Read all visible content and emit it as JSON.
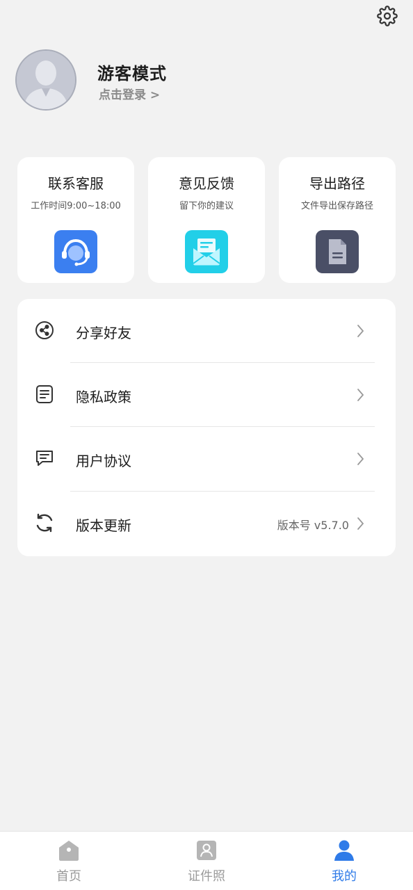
{
  "header": {
    "settings_icon": "gear-icon"
  },
  "profile": {
    "avatar_icon": "default-avatar",
    "name": "游客模式",
    "login_link": "点击登录 >"
  },
  "quick_actions": [
    {
      "title": "联系客服",
      "subtitle": "工作时间9:00~18:00",
      "icon": "customer-service-headset-icon",
      "color": "#3b7ff0"
    },
    {
      "title": "意见反馈",
      "subtitle": "留下你的建议",
      "icon": "envelope-icon",
      "color": "#22cfe8"
    },
    {
      "title": "导出路径",
      "subtitle": "文件导出保存路径",
      "icon": "document-icon",
      "color": "#4a4f66"
    }
  ],
  "menu": [
    {
      "label": "分享好友",
      "icon": "share-icon",
      "value": ""
    },
    {
      "label": "隐私政策",
      "icon": "document-list-icon",
      "value": ""
    },
    {
      "label": "用户协议",
      "icon": "chat-message-icon",
      "value": ""
    },
    {
      "label": "版本更新",
      "icon": "refresh-icon",
      "value": "版本号 v5.7.0"
    }
  ],
  "tabs": [
    {
      "label": "首页",
      "icon": "home-icon",
      "active": false
    },
    {
      "label": "证件照",
      "icon": "id-photo-icon",
      "active": false
    },
    {
      "label": "我的",
      "icon": "user-icon",
      "active": true
    }
  ],
  "colors": {
    "accent": "#2f7be8",
    "inactive_tab": "#9a9a9a",
    "background": "#f2f2f2"
  }
}
